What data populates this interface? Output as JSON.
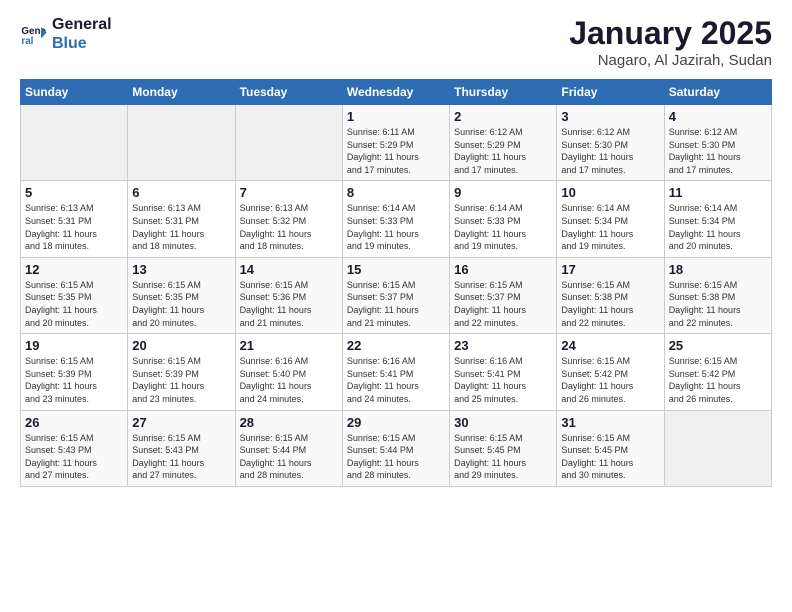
{
  "logo": {
    "line1": "General",
    "line2": "Blue"
  },
  "title": "January 2025",
  "subtitle": "Nagaro, Al Jazirah, Sudan",
  "days_header": [
    "Sunday",
    "Monday",
    "Tuesday",
    "Wednesday",
    "Thursday",
    "Friday",
    "Saturday"
  ],
  "weeks": [
    [
      {
        "day": "",
        "info": ""
      },
      {
        "day": "",
        "info": ""
      },
      {
        "day": "",
        "info": ""
      },
      {
        "day": "1",
        "info": "Sunrise: 6:11 AM\nSunset: 5:29 PM\nDaylight: 11 hours\nand 17 minutes."
      },
      {
        "day": "2",
        "info": "Sunrise: 6:12 AM\nSunset: 5:29 PM\nDaylight: 11 hours\nand 17 minutes."
      },
      {
        "day": "3",
        "info": "Sunrise: 6:12 AM\nSunset: 5:30 PM\nDaylight: 11 hours\nand 17 minutes."
      },
      {
        "day": "4",
        "info": "Sunrise: 6:12 AM\nSunset: 5:30 PM\nDaylight: 11 hours\nand 17 minutes."
      }
    ],
    [
      {
        "day": "5",
        "info": "Sunrise: 6:13 AM\nSunset: 5:31 PM\nDaylight: 11 hours\nand 18 minutes."
      },
      {
        "day": "6",
        "info": "Sunrise: 6:13 AM\nSunset: 5:31 PM\nDaylight: 11 hours\nand 18 minutes."
      },
      {
        "day": "7",
        "info": "Sunrise: 6:13 AM\nSunset: 5:32 PM\nDaylight: 11 hours\nand 18 minutes."
      },
      {
        "day": "8",
        "info": "Sunrise: 6:14 AM\nSunset: 5:33 PM\nDaylight: 11 hours\nand 19 minutes."
      },
      {
        "day": "9",
        "info": "Sunrise: 6:14 AM\nSunset: 5:33 PM\nDaylight: 11 hours\nand 19 minutes."
      },
      {
        "day": "10",
        "info": "Sunrise: 6:14 AM\nSunset: 5:34 PM\nDaylight: 11 hours\nand 19 minutes."
      },
      {
        "day": "11",
        "info": "Sunrise: 6:14 AM\nSunset: 5:34 PM\nDaylight: 11 hours\nand 20 minutes."
      }
    ],
    [
      {
        "day": "12",
        "info": "Sunrise: 6:15 AM\nSunset: 5:35 PM\nDaylight: 11 hours\nand 20 minutes."
      },
      {
        "day": "13",
        "info": "Sunrise: 6:15 AM\nSunset: 5:35 PM\nDaylight: 11 hours\nand 20 minutes."
      },
      {
        "day": "14",
        "info": "Sunrise: 6:15 AM\nSunset: 5:36 PM\nDaylight: 11 hours\nand 21 minutes."
      },
      {
        "day": "15",
        "info": "Sunrise: 6:15 AM\nSunset: 5:37 PM\nDaylight: 11 hours\nand 21 minutes."
      },
      {
        "day": "16",
        "info": "Sunrise: 6:15 AM\nSunset: 5:37 PM\nDaylight: 11 hours\nand 22 minutes."
      },
      {
        "day": "17",
        "info": "Sunrise: 6:15 AM\nSunset: 5:38 PM\nDaylight: 11 hours\nand 22 minutes."
      },
      {
        "day": "18",
        "info": "Sunrise: 6:15 AM\nSunset: 5:38 PM\nDaylight: 11 hours\nand 22 minutes."
      }
    ],
    [
      {
        "day": "19",
        "info": "Sunrise: 6:15 AM\nSunset: 5:39 PM\nDaylight: 11 hours\nand 23 minutes."
      },
      {
        "day": "20",
        "info": "Sunrise: 6:15 AM\nSunset: 5:39 PM\nDaylight: 11 hours\nand 23 minutes."
      },
      {
        "day": "21",
        "info": "Sunrise: 6:16 AM\nSunset: 5:40 PM\nDaylight: 11 hours\nand 24 minutes."
      },
      {
        "day": "22",
        "info": "Sunrise: 6:16 AM\nSunset: 5:41 PM\nDaylight: 11 hours\nand 24 minutes."
      },
      {
        "day": "23",
        "info": "Sunrise: 6:16 AM\nSunset: 5:41 PM\nDaylight: 11 hours\nand 25 minutes."
      },
      {
        "day": "24",
        "info": "Sunrise: 6:15 AM\nSunset: 5:42 PM\nDaylight: 11 hours\nand 26 minutes."
      },
      {
        "day": "25",
        "info": "Sunrise: 6:15 AM\nSunset: 5:42 PM\nDaylight: 11 hours\nand 26 minutes."
      }
    ],
    [
      {
        "day": "26",
        "info": "Sunrise: 6:15 AM\nSunset: 5:43 PM\nDaylight: 11 hours\nand 27 minutes."
      },
      {
        "day": "27",
        "info": "Sunrise: 6:15 AM\nSunset: 5:43 PM\nDaylight: 11 hours\nand 27 minutes."
      },
      {
        "day": "28",
        "info": "Sunrise: 6:15 AM\nSunset: 5:44 PM\nDaylight: 11 hours\nand 28 minutes."
      },
      {
        "day": "29",
        "info": "Sunrise: 6:15 AM\nSunset: 5:44 PM\nDaylight: 11 hours\nand 28 minutes."
      },
      {
        "day": "30",
        "info": "Sunrise: 6:15 AM\nSunset: 5:45 PM\nDaylight: 11 hours\nand 29 minutes."
      },
      {
        "day": "31",
        "info": "Sunrise: 6:15 AM\nSunset: 5:45 PM\nDaylight: 11 hours\nand 30 minutes."
      },
      {
        "day": "",
        "info": ""
      }
    ]
  ]
}
